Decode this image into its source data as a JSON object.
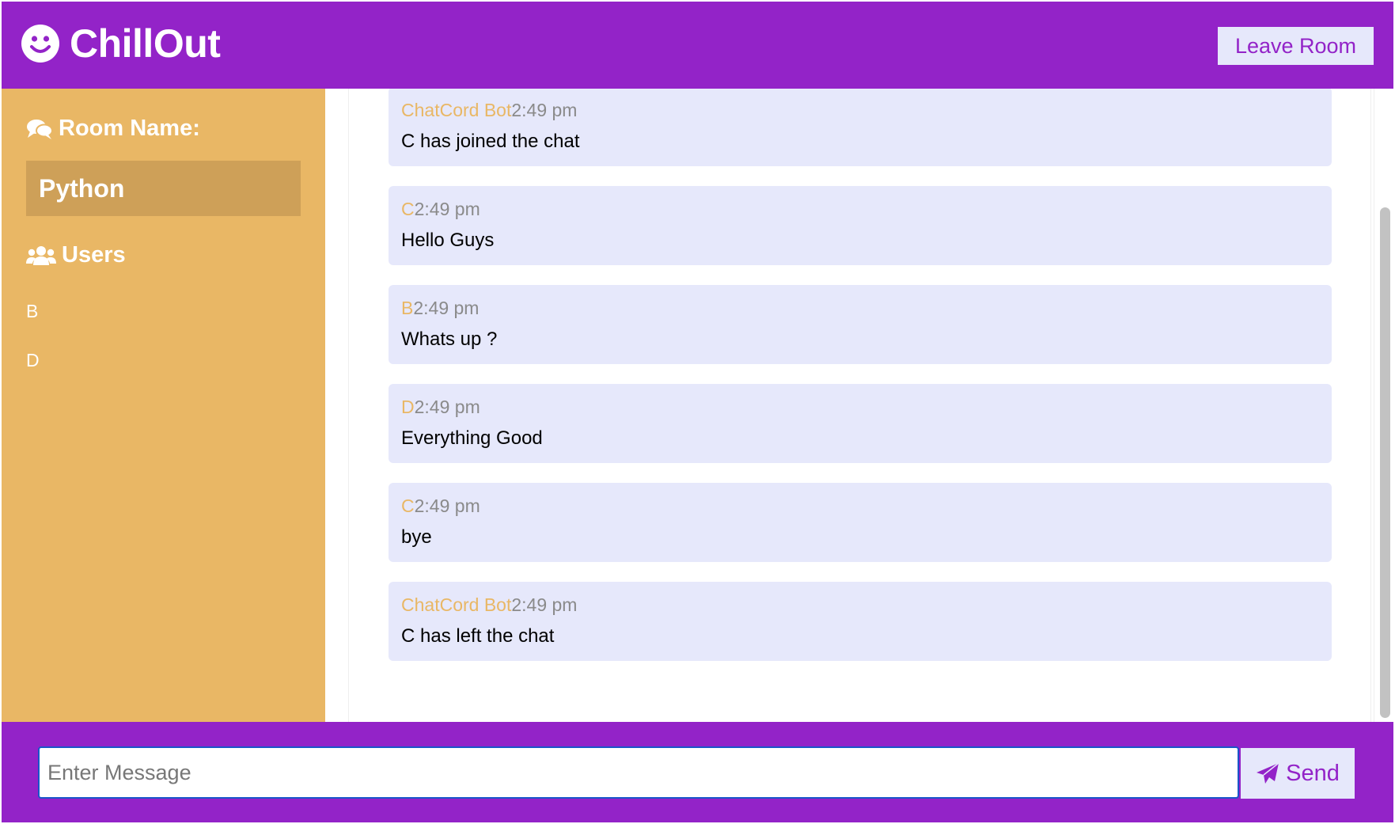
{
  "header": {
    "logo_icon": "smiley-icon",
    "app_name": "ChillOut",
    "leave_button": "Leave Room"
  },
  "sidebar": {
    "room_heading_icon": "comments-icon",
    "room_heading": "Room Name:",
    "room_name": "Python",
    "users_heading_icon": "users-icon",
    "users_heading": "Users",
    "users": [
      "B",
      "D"
    ]
  },
  "messages": [
    {
      "user": "ChatCord Bot",
      "time": "2:49 pm",
      "text": "C has joined the chat"
    },
    {
      "user": "C",
      "time": "2:49 pm",
      "text": "Hello Guys"
    },
    {
      "user": "B",
      "time": "2:49 pm",
      "text": "Whats up ?"
    },
    {
      "user": "D",
      "time": "2:49 pm",
      "text": "Everything Good"
    },
    {
      "user": "C",
      "time": "2:49 pm",
      "text": "bye"
    },
    {
      "user": "ChatCord Bot",
      "time": "2:49 pm",
      "text": "C has left the chat"
    }
  ],
  "composer": {
    "placeholder": "Enter Message",
    "value": "",
    "send_icon": "paper-plane-icon",
    "send_button": "Send"
  },
  "colors": {
    "primary": "#9323c8",
    "secondary": "#e9b765",
    "room_box": "#cea058",
    "message_bg": "#e6e8fb",
    "timestamp": "#8a8a8a"
  }
}
